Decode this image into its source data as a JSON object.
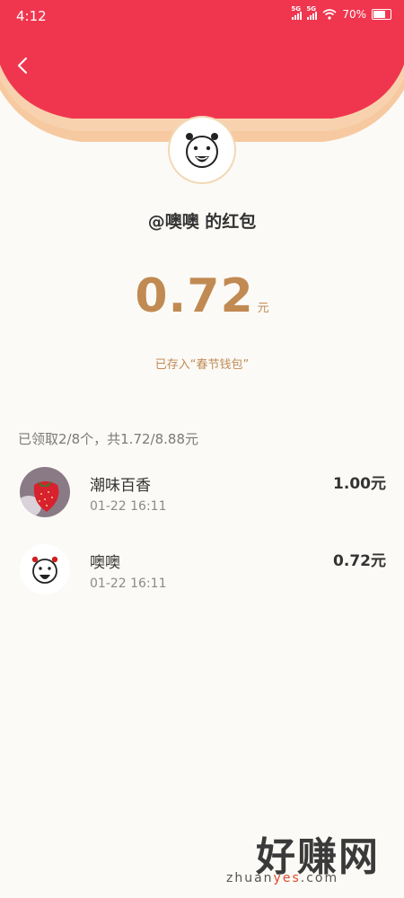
{
  "status_bar": {
    "time": "4:12",
    "signal_1_label": "5G",
    "signal_2_label": "5G",
    "battery_text": "70%"
  },
  "header": {
    "title": "@噢噢 的红包"
  },
  "amount": {
    "value": "0.72",
    "unit": "元",
    "saved_text": "已存入“春节钱包”"
  },
  "summary": {
    "text": "已领取2/8个，共1.72/8.88元"
  },
  "records": [
    {
      "name": "潮味百香",
      "time": "01-22 16:11",
      "amount": "1.00元",
      "avatar": "strawberry-avatar"
    },
    {
      "name": "噢噢",
      "time": "01-22 16:11",
      "amount": "0.72元",
      "avatar": "cartoon-face-avatar"
    }
  ],
  "watermark": {
    "brand": "好赚网",
    "site_prefix": "zhuan",
    "site_highlight": "yes",
    "site_suffix": ".com"
  },
  "colors": {
    "header_red": "#f0364f",
    "accent_gold": "#c18a53",
    "background": "#fbfaf6"
  }
}
